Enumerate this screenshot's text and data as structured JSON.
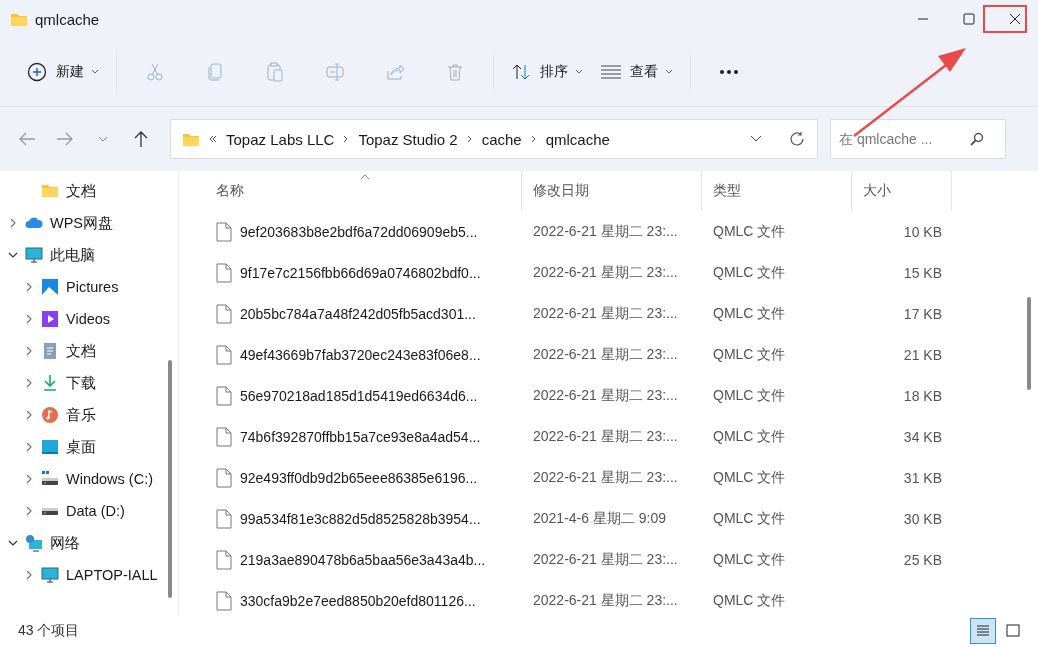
{
  "window": {
    "title": "qmlcache"
  },
  "toolbar": {
    "new_label": "新建",
    "sort_label": "排序",
    "view_label": "查看"
  },
  "address": {
    "segments": [
      "Topaz Labs LLC",
      "Topaz Studio 2",
      "cache",
      "qmlcache"
    ]
  },
  "search": {
    "placeholder": "在 qmlcache ..."
  },
  "sidebar": {
    "items": [
      {
        "label": "文档",
        "kind": "folder"
      },
      {
        "label": "WPS网盘",
        "kind": "cloud",
        "expanded": false
      },
      {
        "label": "此电脑",
        "kind": "pc",
        "expanded": true,
        "children": [
          {
            "label": "Pictures",
            "kind": "pictures",
            "expanded": false
          },
          {
            "label": "Videos",
            "kind": "videos",
            "expanded": false
          },
          {
            "label": "文档",
            "kind": "documents",
            "expanded": false
          },
          {
            "label": "下载",
            "kind": "downloads",
            "expanded": false
          },
          {
            "label": "音乐",
            "kind": "music",
            "expanded": false
          },
          {
            "label": "桌面",
            "kind": "desktop",
            "expanded": false
          },
          {
            "label": "Windows (C:)",
            "kind": "drive-c",
            "expanded": false
          },
          {
            "label": "Data (D:)",
            "kind": "drive",
            "expanded": false
          }
        ]
      },
      {
        "label": "网络",
        "kind": "network",
        "expanded": true,
        "children": [
          {
            "label": "LAPTOP-IALL",
            "kind": "pc",
            "expanded": false
          }
        ]
      }
    ]
  },
  "table": {
    "columns": [
      "名称",
      "修改日期",
      "类型",
      "大小"
    ],
    "rows": [
      {
        "name": "9ef203683b8e2bdf6a72dd06909eb5...",
        "date": "2022-6-21 星期二 23:...",
        "type": "QMLC 文件",
        "size": "10 KB"
      },
      {
        "name": "9f17e7c2156fbb66d69a0746802bdf0...",
        "date": "2022-6-21 星期二 23:...",
        "type": "QMLC 文件",
        "size": "15 KB"
      },
      {
        "name": "20b5bc784a7a48f242d05fb5acd301...",
        "date": "2022-6-21 星期二 23:...",
        "type": "QMLC 文件",
        "size": "17 KB"
      },
      {
        "name": "49ef43669b7fab3720ec243e83f06e8...",
        "date": "2022-6-21 星期二 23:...",
        "type": "QMLC 文件",
        "size": "21 KB"
      },
      {
        "name": "56e970218ad185d1d5419ed6634d6...",
        "date": "2022-6-21 星期二 23:...",
        "type": "QMLC 文件",
        "size": "18 KB"
      },
      {
        "name": "74b6f392870ffbb15a7ce93e8a4ad54...",
        "date": "2022-6-21 星期二 23:...",
        "type": "QMLC 文件",
        "size": "34 KB"
      },
      {
        "name": "92e493ff0db9d2b65eee86385e6196...",
        "date": "2022-6-21 星期二 23:...",
        "type": "QMLC 文件",
        "size": "31 KB"
      },
      {
        "name": "99a534f81e3c882d5d8525828b3954...",
        "date": "2021-4-6 星期二 9:09",
        "type": "QMLC 文件",
        "size": "30 KB"
      },
      {
        "name": "219a3ae890478b6a5baa56e3a43a4b...",
        "date": "2022-6-21 星期二 23:...",
        "type": "QMLC 文件",
        "size": "25 KB"
      },
      {
        "name": "330cfa9b2e7eed8850b20efd801126...",
        "date": "2022-6-21 星期二 23:...",
        "type": "QMLC 文件"
      }
    ]
  },
  "status_bar": {
    "count": "43 个项目",
    "view_modes": [
      {
        "kind": "details",
        "selected": true
      },
      {
        "kind": "tiles",
        "selected": false
      }
    ]
  }
}
